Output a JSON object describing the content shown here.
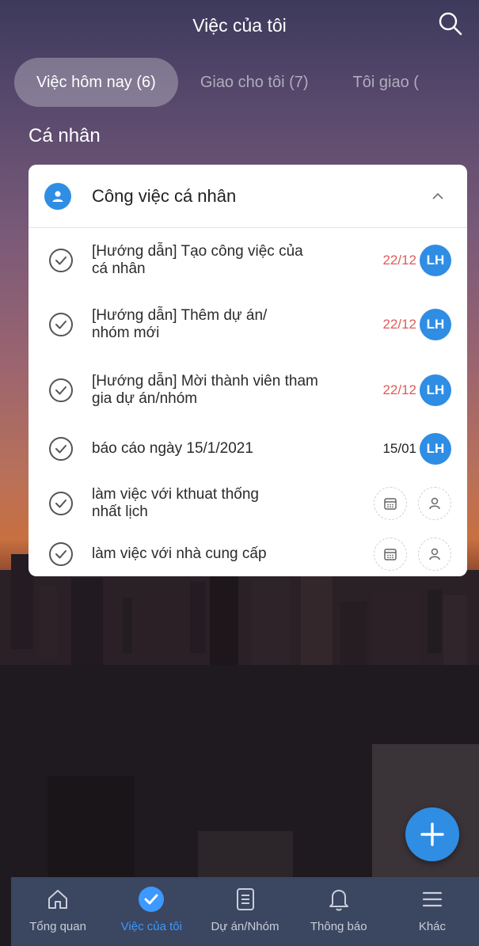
{
  "header": {
    "title": "Việc của tôi"
  },
  "tabs": [
    {
      "label": "Việc hôm nay (6)",
      "active": true
    },
    {
      "label": "Giao cho tôi (7)",
      "active": false
    },
    {
      "label": "Tôi giao (",
      "active": false
    }
  ],
  "section": {
    "title": "Cá nhân"
  },
  "card": {
    "title": "Công việc cá nhân",
    "tasks": [
      {
        "line1": "[Hướng dẫn] Tạo công việc của",
        "line2": "cá nhân",
        "date": "22/12",
        "date_status": "overdue",
        "assignee": "LH"
      },
      {
        "line1": "[Hướng dẫn] Thêm dự án/",
        "line2": "nhóm mới",
        "date": "22/12",
        "date_status": "overdue",
        "assignee": "LH"
      },
      {
        "line1": "[Hướng dẫn] Mời thành viên tham",
        "line2": "gia dự án/nhóm",
        "date": "22/12",
        "date_status": "overdue",
        "assignee": "LH"
      },
      {
        "line1": "báo cáo ngày 15/1/2021",
        "line2": "",
        "date": "15/01",
        "date_status": "normal",
        "assignee": "LH"
      },
      {
        "line1": "làm việc với kthuat thống",
        "line2": "nhất lịch",
        "date": "",
        "date_status": "none",
        "assignee": ""
      },
      {
        "line1": "làm việc với nhà cung cấp",
        "line2": "",
        "date": "",
        "date_status": "none",
        "assignee": ""
      }
    ]
  },
  "bottom_nav": [
    {
      "label": "Tổng quan",
      "icon": "home-icon",
      "active": false
    },
    {
      "label": "Việc của tôi",
      "icon": "check-circle-icon",
      "active": true
    },
    {
      "label": "Dự án/Nhóm",
      "icon": "clipboard-icon",
      "active": false
    },
    {
      "label": "Thông báo",
      "icon": "bell-icon",
      "active": false
    },
    {
      "label": "Khác",
      "icon": "menu-icon",
      "active": false
    }
  ],
  "colors": {
    "accent": "#2f8de4",
    "overdue": "#e05a5a",
    "nav_bg": "#3b4660",
    "nav_active": "#3d98ff"
  }
}
